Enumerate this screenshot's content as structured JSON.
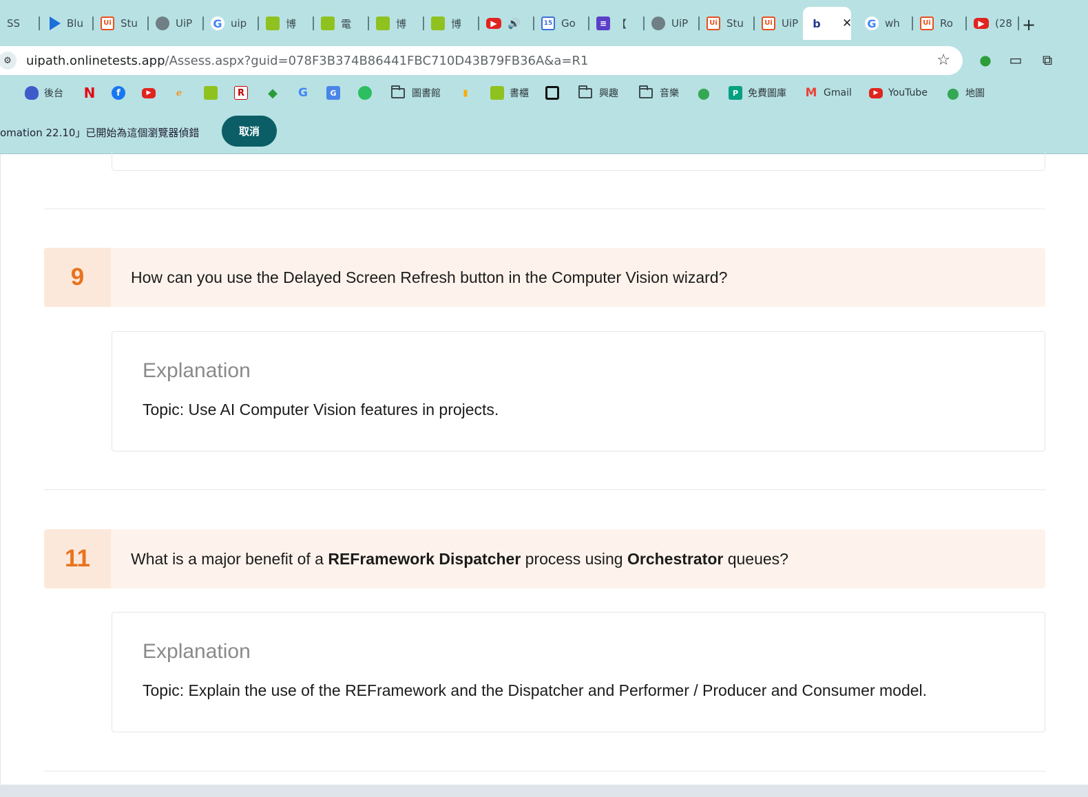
{
  "browser": {
    "tabs": [
      {
        "icon": "globe-icon",
        "label": "SS"
      },
      {
        "icon": "azure-arrow-icon",
        "label": "Blu"
      },
      {
        "icon": "uipath-icon",
        "label": "Stu"
      },
      {
        "icon": "globe-icon",
        "label": "UiP"
      },
      {
        "icon": "google-icon",
        "label": "uip"
      },
      {
        "icon": "green-book-icon",
        "label": "博"
      },
      {
        "icon": "green-book-icon",
        "label": "電"
      },
      {
        "icon": "green-book-icon",
        "label": "博"
      },
      {
        "icon": "green-book-icon",
        "label": "博"
      },
      {
        "icon": "youtube-icon",
        "label": "🔊"
      },
      {
        "icon": "calendar-icon",
        "label": "Go"
      },
      {
        "icon": "purple-list-icon",
        "label": "【"
      },
      {
        "icon": "globe-icon",
        "label": "UiP"
      },
      {
        "icon": "uipath-icon",
        "label": "Stu"
      },
      {
        "icon": "uipath-icon",
        "label": "UiP"
      },
      {
        "icon": "bing-icon",
        "label": ""
      },
      {
        "icon": "google-icon",
        "label": "wh"
      },
      {
        "icon": "uipath-icon",
        "label": "Ro"
      },
      {
        "icon": "youtube-icon",
        "label": "(28"
      }
    ],
    "active_tab_index": 15,
    "close_tab_glyph": "✕",
    "new_tab_glyph": "+",
    "address": {
      "host": "uipath.onlinetests.app",
      "path": "/Assess.aspx?guid=078F3B374B86441FBC710D43B79FB36A&a=R1"
    },
    "bookmarks": [
      {
        "icon": "discord-icon",
        "label": "後台"
      },
      {
        "icon": "netflix-icon",
        "label": ""
      },
      {
        "icon": "facebook-icon",
        "label": ""
      },
      {
        "icon": "youtube-icon",
        "label": ""
      },
      {
        "icon": "orange-swirl-icon",
        "label": ""
      },
      {
        "icon": "green-book-icon",
        "label": ""
      },
      {
        "icon": "rakuten-icon",
        "label": ""
      },
      {
        "icon": "green-diamond-icon",
        "label": ""
      },
      {
        "icon": "google-icon",
        "label": ""
      },
      {
        "icon": "translate-icon",
        "label": ""
      },
      {
        "icon": "evernote-icon",
        "label": ""
      },
      {
        "icon": "folder-icon",
        "label": "圖書館"
      },
      {
        "icon": "analytics-icon",
        "label": ""
      },
      {
        "icon": "green-book-icon",
        "label": "書櫃"
      },
      {
        "icon": "square-icon",
        "label": ""
      },
      {
        "icon": "folder-icon",
        "label": "興趣"
      },
      {
        "icon": "folder-icon",
        "label": "音樂"
      },
      {
        "icon": "maps-icon",
        "label": ""
      },
      {
        "icon": "image-icon",
        "label": "免費圖庫"
      },
      {
        "icon": "gmail-icon",
        "label": "Gmail"
      },
      {
        "icon": "youtube-icon",
        "label": "YouTube"
      },
      {
        "icon": "maps-icon",
        "label": "地圖"
      }
    ],
    "infobar": {
      "text": "omation 22.10」已開始為這個瀏覽器偵錯",
      "cancel_label": "取消"
    }
  },
  "questions": [
    {
      "number": "9",
      "text_parts": [
        {
          "t": "How can you use the Delayed Screen Refresh button in the Computer Vision wizard?",
          "bold": false
        }
      ],
      "explanation_title": "Explanation",
      "topic": "Topic: Use AI Computer Vision features in projects."
    },
    {
      "number": "11",
      "text_parts": [
        {
          "t": "What is a major benefit of a ",
          "bold": false
        },
        {
          "t": "REFramework Dispatcher",
          "bold": true
        },
        {
          "t": " process using ",
          "bold": false
        },
        {
          "t": "Orchestrator",
          "bold": true
        },
        {
          "t": " queues?",
          "bold": false
        }
      ],
      "explanation_title": "Explanation",
      "topic": "Topic: Explain the use of the REFramework and the Dispatcher and Performer / Producer and Consumer model."
    }
  ],
  "colors": {
    "chrome_bg": "#b8e1e4",
    "question_number": "#e8731e",
    "question_bg": "#fdf3ec",
    "cancel_button": "#0b5e66"
  }
}
